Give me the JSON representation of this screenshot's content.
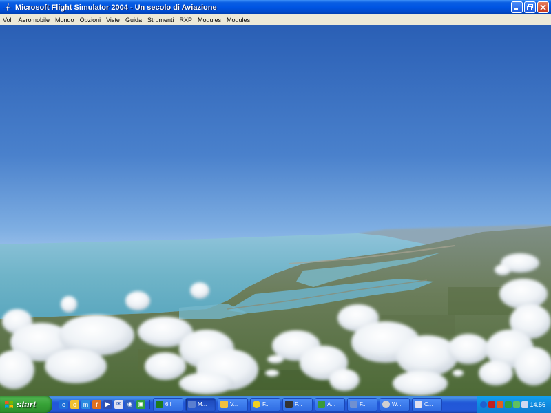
{
  "window": {
    "title": "Microsoft Flight Simulator 2004 - Un secolo di Aviazione",
    "icon": "airplane-icon",
    "buttons": [
      "minimize",
      "restore",
      "close"
    ]
  },
  "menu": {
    "items": [
      "Voli",
      "Aeromobile",
      "Mondo",
      "Opzioni",
      "Viste",
      "Guida",
      "Strumenti",
      "RXP",
      "Modules",
      "Modules"
    ]
  },
  "scene": {
    "description_icon": "flight-sim-view",
    "sky_top_color": "#2a5fb5",
    "sky_horizon_color": "#a7c8ee",
    "sea_color": "#6fb4c8"
  },
  "taskbar": {
    "start_label": "start",
    "quicklaunch": [
      "ie-icon",
      "outlook-icon",
      "messenger-icon",
      "firefox-icon",
      "media-icon",
      "mail-icon",
      "app-icon",
      "app2-icon"
    ],
    "tasks": [
      {
        "label": "6 I",
        "icon": "excel-icon",
        "color": "#1e7a1e",
        "active": false
      },
      {
        "label": "M...",
        "icon": "fs-icon",
        "color": "#5a7fd0",
        "active": true
      },
      {
        "label": "V...",
        "icon": "folder-icon",
        "color": "#f0c040",
        "active": false
      },
      {
        "label": "F...",
        "icon": "smiley-icon",
        "color": "#f0d020",
        "active": false
      },
      {
        "label": "F...",
        "icon": "monitor-icon",
        "color": "#333333",
        "active": false
      },
      {
        "label": "A...",
        "icon": "tool-icon",
        "color": "#3a9a3a",
        "active": false
      },
      {
        "label": "F...",
        "icon": "plane-icon",
        "color": "#7090d0",
        "active": false
      },
      {
        "label": "W...",
        "icon": "wheel-icon",
        "color": "#d0d0d0",
        "active": false
      },
      {
        "label": "C...",
        "icon": "doc-icon",
        "color": "#e0e0f0",
        "active": false
      }
    ],
    "clock": "14.56"
  }
}
